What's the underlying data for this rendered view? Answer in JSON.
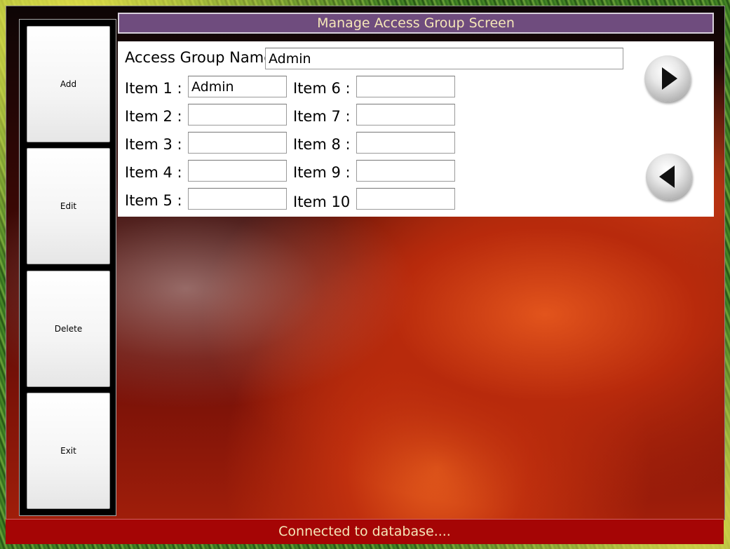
{
  "sidebar": {
    "add_label": "Add",
    "edit_label": "Edit",
    "delete_label": "Delete",
    "exit_label": "Exit"
  },
  "header": {
    "title": "Manage Access Group Screen"
  },
  "form": {
    "group_name_label": "Access Group Name",
    "group_name_value": "Admin",
    "items": [
      {
        "label": "Item 1 :",
        "value": "Admin"
      },
      {
        "label": "Item 2 :",
        "value": ""
      },
      {
        "label": "Item 3 :",
        "value": ""
      },
      {
        "label": "Item 4 :",
        "value": ""
      },
      {
        "label": "Item 5 :",
        "value": ""
      },
      {
        "label": "Item 6 :",
        "value": ""
      },
      {
        "label": "Item 7 :",
        "value": ""
      },
      {
        "label": "Item 8 :",
        "value": ""
      },
      {
        "label": "Item 9 :",
        "value": ""
      },
      {
        "label": "Item 10",
        "value": ""
      }
    ]
  },
  "navigation": {
    "next_icon": "play-right-icon",
    "prev_icon": "play-left-icon"
  },
  "status": {
    "text": "Connected to database...."
  },
  "colors": {
    "title_bg": "#6f4c7e",
    "title_text": "#f5e6b8",
    "status_bg": "#a50505"
  }
}
